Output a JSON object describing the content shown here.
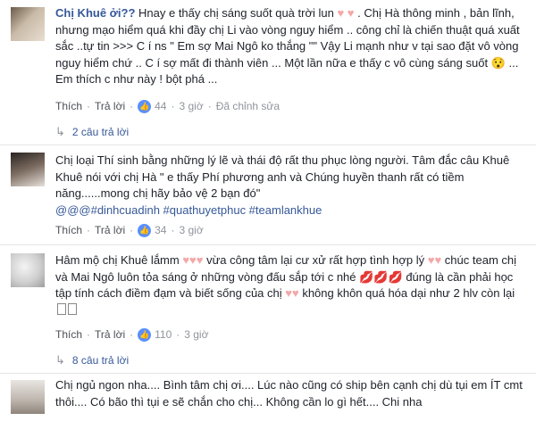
{
  "comments": [
    {
      "author": "Chị Khuê ởi??",
      "text_parts": [
        " Hnay e thấy chị sáng suốt quà trời lun ",
        "♥ ♥",
        " . Chị Hà thông minh , bản lĩnh, nhưng mạo hiểm quá khi đầy chị Li vào vòng nguy hiểm .. công chỉ là chiến thuật quá xuất sắc ..tự tin >>> C í ns \" Em sợ Mai Ngô ko thắng \"\" Vậy Li mạnh như v tại sao đặt vô vòng nguy hiểm chứ .. C í sợ mất đi thành viên ... Một lần nữa e thấy c vô cùng sáng suốt 😯 ... Em thích c như này ! bột phá ..."
      ],
      "like_label": "Thích",
      "reply_label": "Trả lời",
      "reactions": "44",
      "time": "3 giờ",
      "edited": "Đã chỉnh sửa",
      "replies_label": "2 câu trả lời"
    },
    {
      "author": "",
      "text": "Thí sinh bằng những lý lẽ và thái độ rất thu phục lòng người. Tâm đắc câu Khuê Khuê nói với chị Hà \" e thấy Phí phương anh và Chúng huyền thanh rất có tiềm năng......mong chị hãy bảo vệ 2 bạn đó\"",
      "lead": "Chị loại",
      "hashtags": "@@@#dinhcuadinh #quathuyetphuc #teamlankhue",
      "like_label": "Thích",
      "reply_label": "Trả lời",
      "reactions": "34",
      "time": "3 giờ"
    },
    {
      "text_a": "Hâm mộ chị Khuê lắmm ",
      "hearts_a": "♥♥♥",
      "text_b": " vừa công tâm lại cư xử rất hợp tình hợp lý ",
      "hearts_b": "♥♥",
      "text_c": " chúc team chị và Mai Ngô luôn tỏa sáng ở những vòng đấu sắp tới c nhé ",
      "lips": "💋💋💋",
      "text_d": " đúng là cần phải học tập tính cách điềm đạm và biết sống của chị ",
      "hearts_c": "♥♥",
      "text_e": " không khôn quá hóa dại như 2 hlv còn lại",
      "like_label": "Thích",
      "reply_label": "Trả lời",
      "reactions": "110",
      "time": "3 giờ",
      "replies_label": "8 câu trả lời"
    },
    {
      "text": "Chị ngủ ngon nha.... Bình tâm chị ơi.... Lúc nào cũng có ship bên cạnh chị dù tụi em ÍT cmt thôi.... Có bão thì tụi e sẽ chắn cho chị... Không cần lo gì hết.... Chi nha"
    }
  ]
}
